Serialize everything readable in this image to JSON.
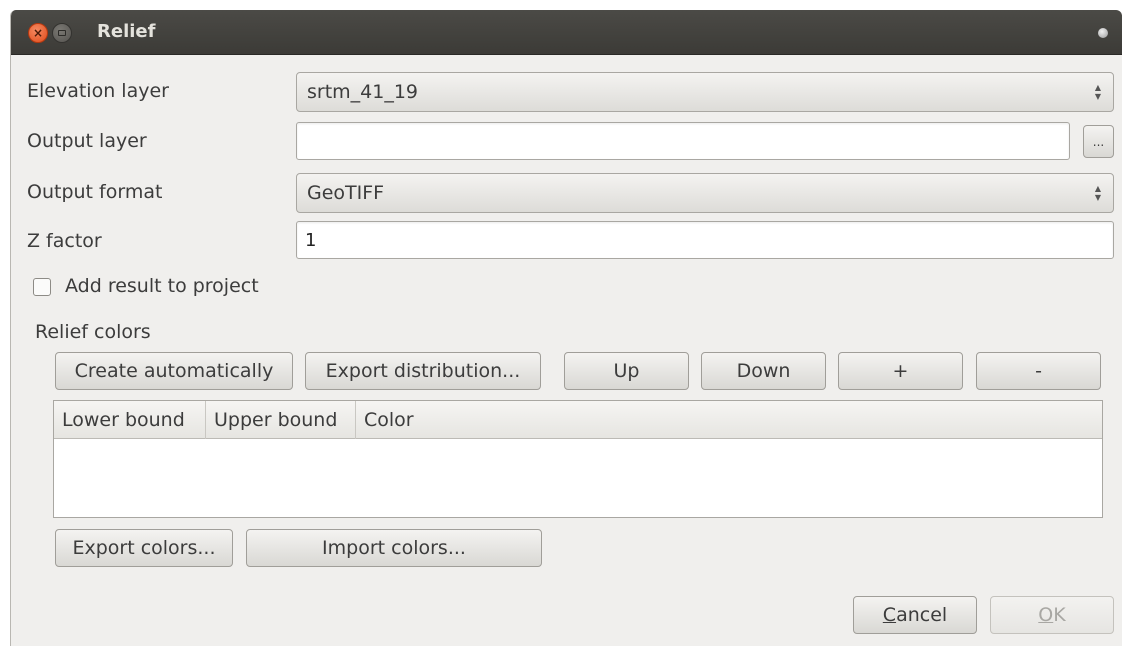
{
  "window": {
    "title": "Relief"
  },
  "form": {
    "elevation_label": "Elevation layer",
    "elevation_value": "srtm_41_19",
    "output_label": "Output layer",
    "output_value": "",
    "browse_label": "...",
    "format_label": "Output format",
    "format_value": "GeoTIFF",
    "zfactor_label": "Z factor",
    "zfactor_value": "1",
    "add_result_label": "Add result to project",
    "add_result_checked": false
  },
  "relief": {
    "section_label": "Relief colors",
    "buttons": {
      "create": "Create automatically",
      "export_dist": "Export distribution...",
      "up": "Up",
      "down": "Down",
      "plus": "+",
      "minus": "-"
    },
    "table": {
      "columns": [
        "Lower bound",
        "Upper bound",
        "Color"
      ],
      "rows": []
    },
    "export_colors": "Export colors...",
    "import_colors": "Import colors..."
  },
  "footer": {
    "cancel_mnemonic": "C",
    "cancel_rest": "ancel",
    "ok_mnemonic": "O",
    "ok_rest": "K"
  },
  "colors": {
    "titlebar": "#3c3b37",
    "close_button": "#df4b1a",
    "dialog_bg": "#f0efed"
  }
}
